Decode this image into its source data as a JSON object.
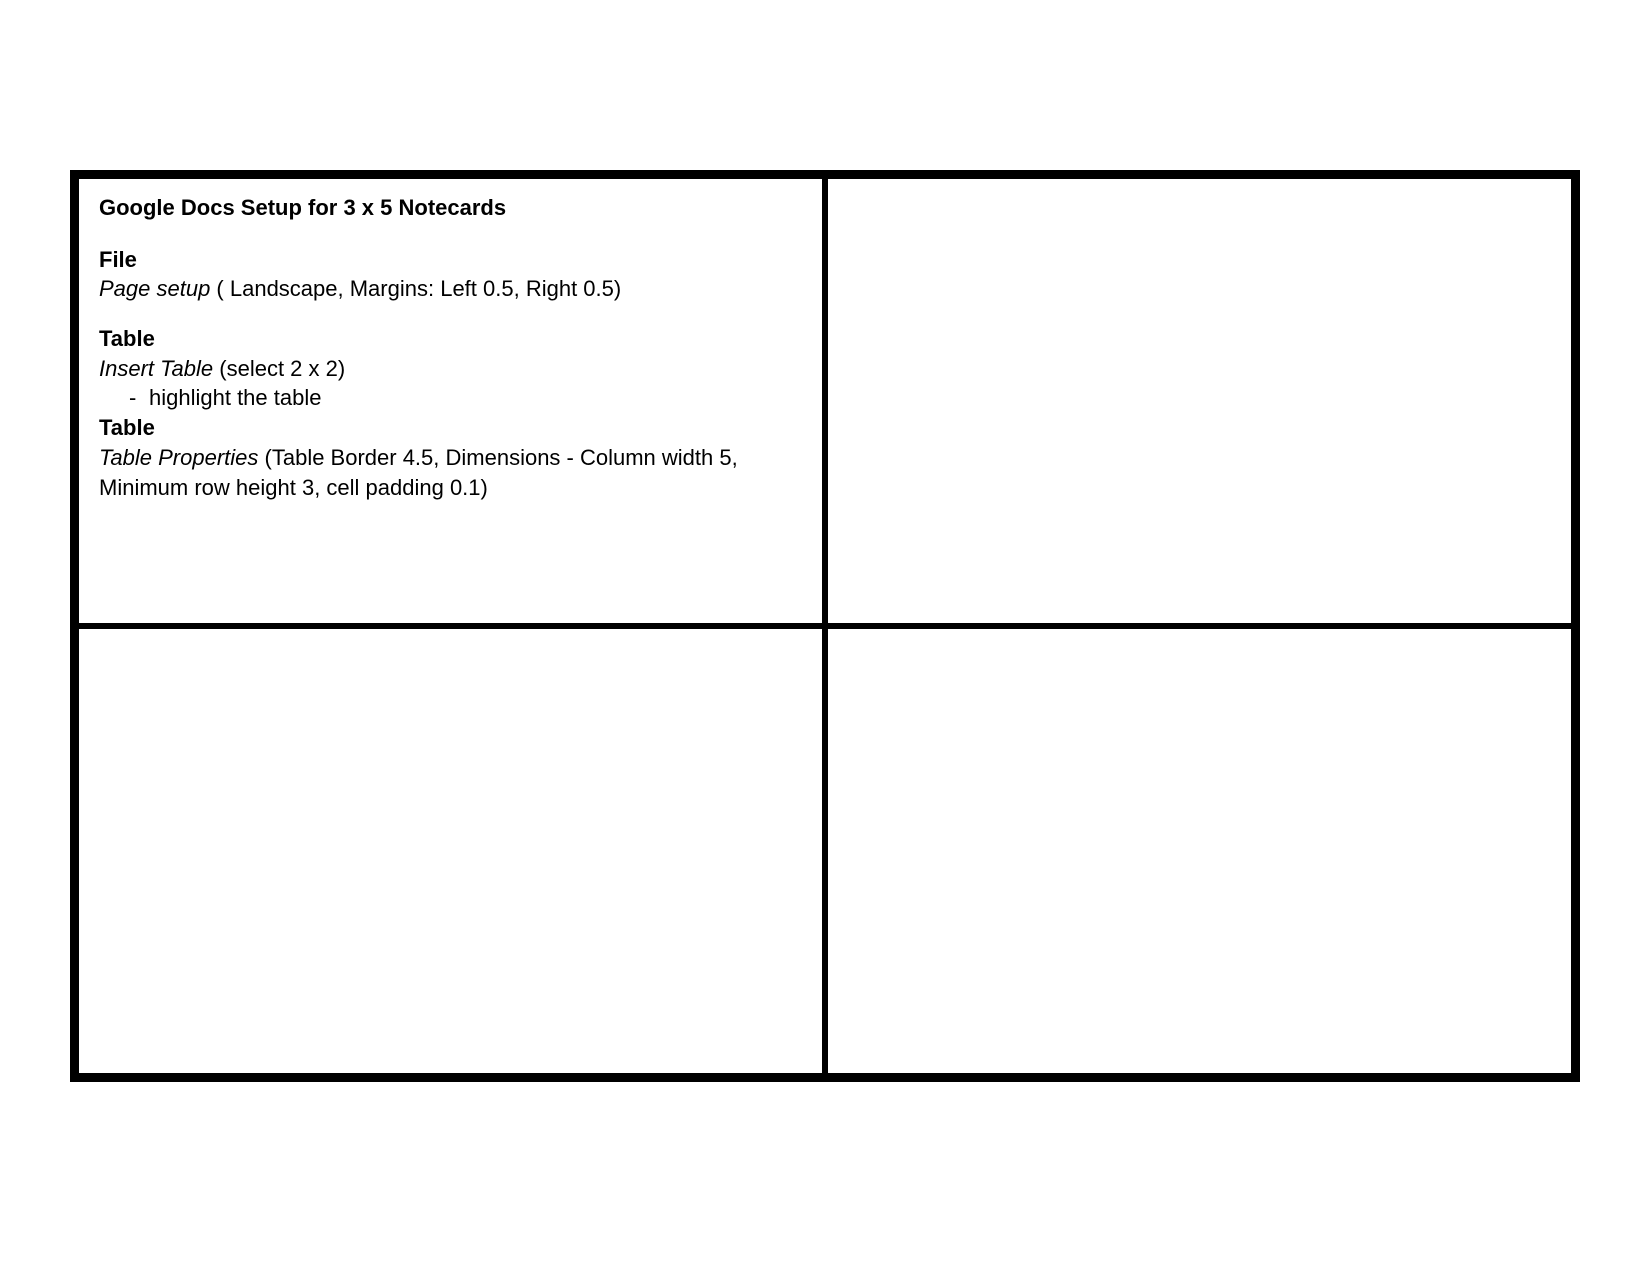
{
  "card1": {
    "title": "Google Docs Setup for 3 x 5 Notecards",
    "section1_head": "File",
    "section1_line_italic": "Page setup",
    "section1_line_rest": " ( Landscape, Margins: Left 0.5, Right 0.5)",
    "section2_head": "Table",
    "section2_line_italic": "Insert Table",
    "section2_line_rest": " (select 2 x 2)",
    "section2_bullet": "highlight the table",
    "section3_head": "Table",
    "section3_line_italic": "Table Properties",
    "section3_line_rest": " (Table Border  4.5, Dimensions - Column width 5, Minimum row height 3, cell padding 0.1)"
  }
}
